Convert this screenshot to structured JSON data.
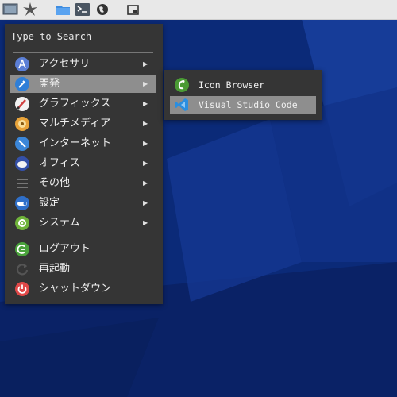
{
  "colors": {
    "panel_bg": "#e8e8e8",
    "menu_bg": "#353535",
    "highlight": "#8e8e8e",
    "wallpaper": "#0b2a78"
  },
  "panel": {
    "launchers": [
      "desktop-icon",
      "app-menu-icon",
      "file-manager-icon",
      "terminal-icon",
      "web-browser-icon",
      "window-switcher-icon"
    ]
  },
  "menu": {
    "search_placeholder": "Type to Search",
    "categories": [
      {
        "label": "アクセサリ",
        "icon": "accessories-icon"
      },
      {
        "label": "開発",
        "icon": "development-icon",
        "selected": true
      },
      {
        "label": "グラフィックス",
        "icon": "graphics-icon"
      },
      {
        "label": "マルチメディア",
        "icon": "multimedia-icon"
      },
      {
        "label": "インターネット",
        "icon": "internet-icon"
      },
      {
        "label": "オフィス",
        "icon": "office-icon"
      },
      {
        "label": "その他",
        "icon": "other-icon"
      },
      {
        "label": "設定",
        "icon": "settings-icon"
      },
      {
        "label": "システム",
        "icon": "system-icon"
      }
    ],
    "actions": [
      {
        "label": "ログアウト",
        "icon": "logout-icon"
      },
      {
        "label": "再起動",
        "icon": "reboot-icon"
      },
      {
        "label": "シャットダウン",
        "icon": "shutdown-icon"
      }
    ],
    "arrow": "▶"
  },
  "submenu": {
    "items": [
      {
        "label": "Icon Browser",
        "icon": "icon-browser-icon"
      },
      {
        "label": "Visual Studio Code",
        "icon": "vscode-icon",
        "selected": true
      }
    ]
  }
}
